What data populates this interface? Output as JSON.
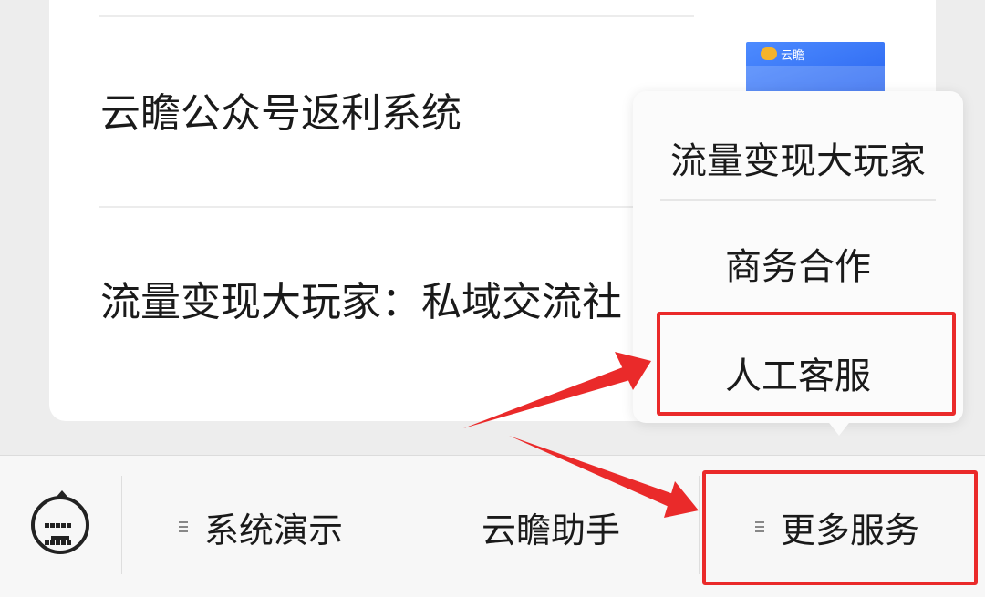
{
  "articles": [
    {
      "title": "云瞻公众号返利系统"
    },
    {
      "title": "流量变现大玩家：私域交流社"
    }
  ],
  "thumbnail": {
    "logo_text": "云瞻"
  },
  "popup_menu": {
    "items": [
      "流量变现大玩家",
      "商务合作",
      "人工客服"
    ]
  },
  "bottom_bar": {
    "keyboard_icon": "keyboard-icon",
    "menu_1": "系统演示",
    "menu_2": "云瞻助手",
    "menu_3": "更多服务"
  },
  "colors": {
    "highlight_red": "#ea2a2a",
    "background": "#ededed"
  }
}
